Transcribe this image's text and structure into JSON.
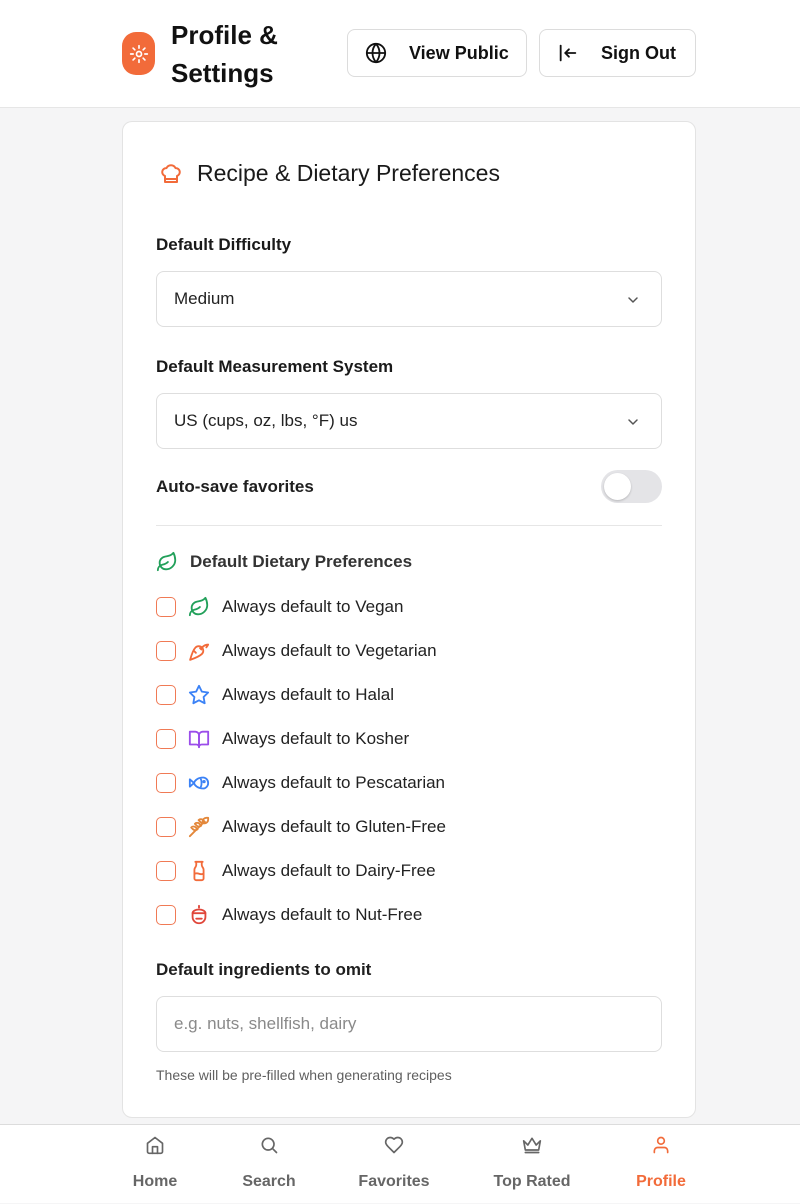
{
  "header": {
    "title": "Profile & Settings",
    "view_public_label": "View Public",
    "sign_out_label": "Sign Out"
  },
  "card": {
    "title": "Recipe & Dietary Preferences",
    "difficulty_label": "Default Difficulty",
    "difficulty_value": "Medium",
    "measurement_label": "Default Measurement System",
    "measurement_value": "US (cups, oz, lbs, °F) us",
    "autosave_label": "Auto-save favorites",
    "autosave_enabled": false,
    "dietary_heading": "Default Dietary Preferences",
    "dietary_items": [
      {
        "label": "Always default to Vegan",
        "icon": "leaf-icon",
        "color": "#22a05a",
        "checked": false
      },
      {
        "label": "Always default to Vegetarian",
        "icon": "carrot-icon",
        "color": "#f26b3a",
        "checked": false
      },
      {
        "label": "Always default to Halal",
        "icon": "star-icon",
        "color": "#3b82f6",
        "checked": false
      },
      {
        "label": "Always default to Kosher",
        "icon": "book-icon",
        "color": "#9b4dea",
        "checked": false
      },
      {
        "label": "Always default to Pescatarian",
        "icon": "fish-icon",
        "color": "#3b82f6",
        "checked": false
      },
      {
        "label": "Always default to Gluten-Free",
        "icon": "wheat-icon",
        "color": "#e3873a",
        "checked": false
      },
      {
        "label": "Always default to Dairy-Free",
        "icon": "milk-icon",
        "color": "#f26b3a",
        "checked": false
      },
      {
        "label": "Always default to Nut-Free",
        "icon": "nut-icon",
        "color": "#e0463a",
        "checked": false
      }
    ],
    "omit_label": "Default ingredients to omit",
    "omit_placeholder": "e.g. nuts, shellfish, dairy",
    "omit_value": "",
    "omit_hint": "These will be pre-filled when generating recipes"
  },
  "nav": {
    "items": [
      {
        "label": "Home",
        "icon": "home-icon",
        "active": false
      },
      {
        "label": "Search",
        "icon": "search-icon",
        "active": false
      },
      {
        "label": "Favorites",
        "icon": "heart-icon",
        "active": false
      },
      {
        "label": "Top Rated",
        "icon": "crown-icon",
        "active": false
      },
      {
        "label": "Profile",
        "icon": "user-icon",
        "active": true
      }
    ]
  },
  "colors": {
    "accent": "#f26b3a",
    "toggle_off": "#e4e4e7",
    "checkbox_border": "#f07a55"
  }
}
